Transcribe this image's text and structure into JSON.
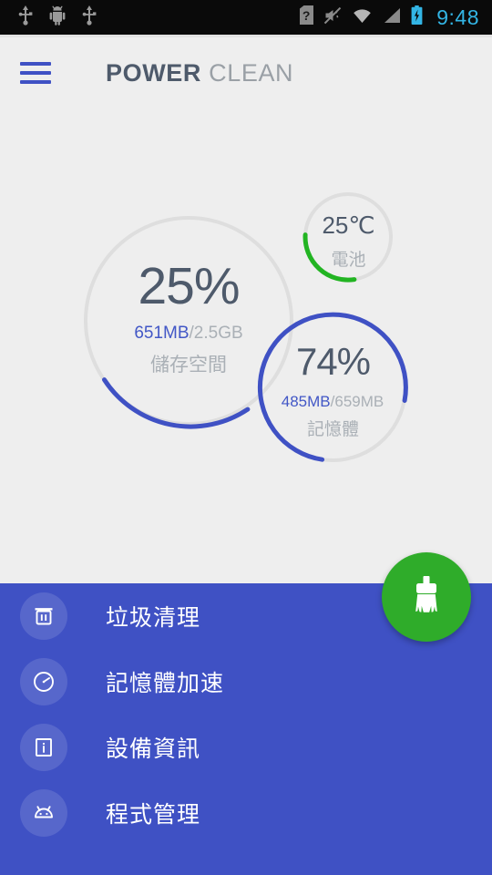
{
  "statusbar": {
    "time": "9:48",
    "left_icons": [
      "usb-icon",
      "android-debug-icon",
      "usb-icon"
    ],
    "right_icons": [
      "sim-unknown-icon",
      "silent-mode-icon",
      "wifi-icon",
      "cell-signal-icon",
      "battery-charging-icon"
    ],
    "time_color": "#33b5e5",
    "background": "#0a0a0a"
  },
  "appbar": {
    "menu_icon": "hamburger-menu-icon",
    "title_bold": "POWER",
    "title_light": "CLEAN",
    "accent": "#3f51c4"
  },
  "dials": {
    "storage": {
      "percent_label": "25%",
      "percent_value": 25,
      "used": "651MB",
      "separator": "/",
      "total": "2.5GB",
      "name": "儲存空間",
      "arc_color": "#3f51c4",
      "track_color": "#dedede"
    },
    "memory": {
      "percent_label": "74%",
      "percent_value": 74,
      "used": "485MB",
      "separator": "/",
      "total": "659MB",
      "name": "記憶體",
      "arc_color": "#3f51c4",
      "track_color": "#dedede"
    },
    "battery": {
      "temperature_label": "25℃",
      "percent_value": 33,
      "name": "電池",
      "arc_color": "#22b422",
      "track_color": "#dedede"
    }
  },
  "fab": {
    "icon": "broom-clean-icon",
    "color": "#2fac2a"
  },
  "panel": {
    "background": "#3f51c4",
    "items": [
      {
        "icon": "trash-icon",
        "label": "垃圾清理"
      },
      {
        "icon": "speedometer-icon",
        "label": "記憶體加速"
      },
      {
        "icon": "info-icon",
        "label": "設備資訊"
      },
      {
        "icon": "android-icon",
        "label": "程式管理"
      }
    ]
  }
}
